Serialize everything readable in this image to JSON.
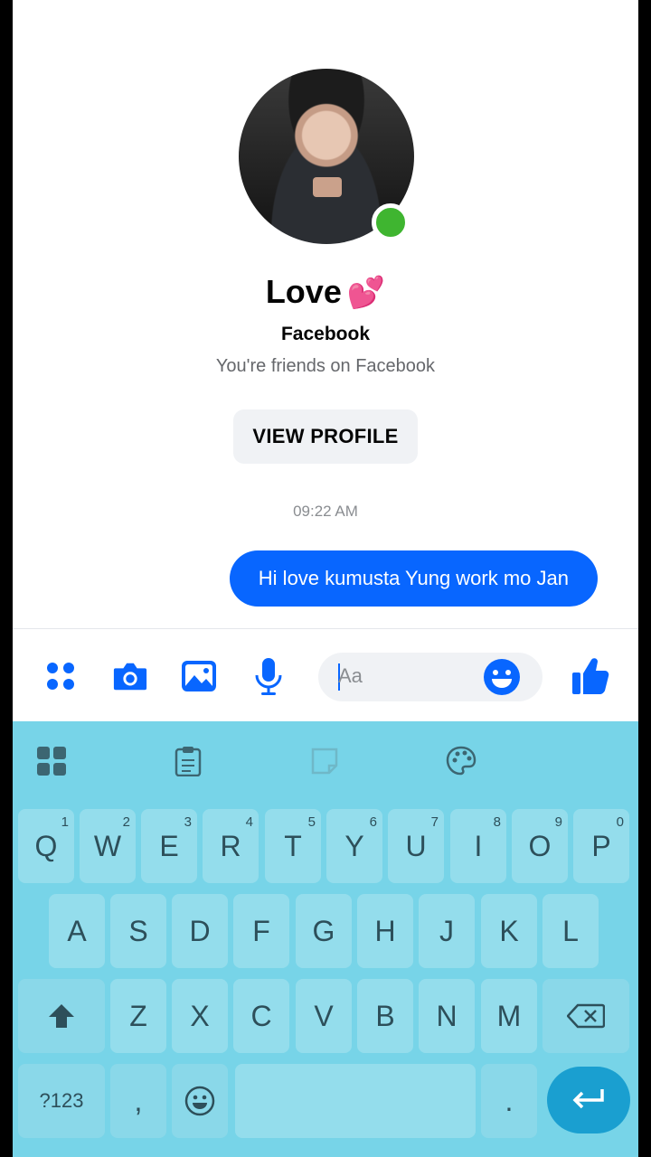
{
  "contact": {
    "name": "Love",
    "name_emoji": "💕",
    "source": "Facebook",
    "friend_status": "You're friends on Facebook",
    "online": true
  },
  "actions": {
    "view_profile": "VIEW PROFILE"
  },
  "conversation": {
    "timestamp": "09:22 AM",
    "messages": [
      {
        "from": "me",
        "text": "Hi love kumusta Yung work mo Jan"
      }
    ]
  },
  "composer": {
    "placeholder": "Aa",
    "icons": [
      "apps-icon",
      "camera-icon",
      "gallery-icon",
      "microphone-icon",
      "emoji-icon",
      "like-icon"
    ],
    "accent_color": "#0866ff"
  },
  "keyboard": {
    "toolbar_icons": [
      "grid-icon",
      "clipboard-icon",
      "sticker-icon",
      "palette-icon"
    ],
    "row1": [
      {
        "k": "Q",
        "s": "1"
      },
      {
        "k": "W",
        "s": "2"
      },
      {
        "k": "E",
        "s": "3"
      },
      {
        "k": "R",
        "s": "4"
      },
      {
        "k": "T",
        "s": "5"
      },
      {
        "k": "Y",
        "s": "6"
      },
      {
        "k": "U",
        "s": "7"
      },
      {
        "k": "I",
        "s": "8"
      },
      {
        "k": "O",
        "s": "9"
      },
      {
        "k": "P",
        "s": "0"
      }
    ],
    "row2": [
      "A",
      "S",
      "D",
      "F",
      "G",
      "H",
      "J",
      "K",
      "L"
    ],
    "row3": [
      "Z",
      "X",
      "C",
      "V",
      "B",
      "N",
      "M"
    ],
    "symbols_label": "?123",
    "comma": ",",
    "period": ".",
    "background_color": "#77d4e8"
  }
}
